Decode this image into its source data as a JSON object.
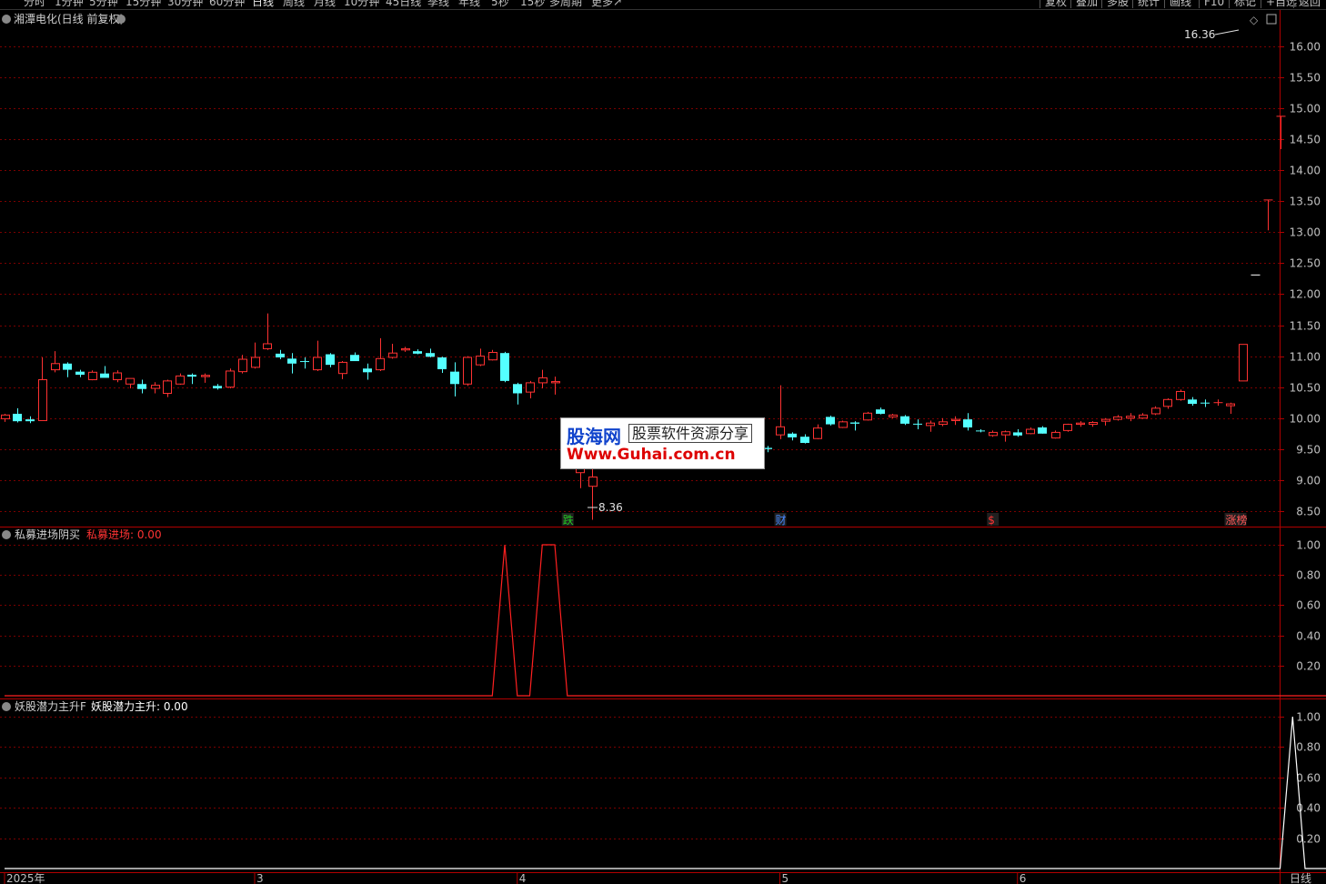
{
  "toolbar": {
    "periods": [
      "分时",
      "1分钟",
      "5分钟",
      "15分钟",
      "30分钟",
      "60分钟",
      "日线",
      "周线",
      "月线",
      "10分钟",
      "45日线",
      "季线",
      "年线",
      "5秒",
      "15秒",
      "多周期",
      "更多↗"
    ],
    "active_period": "日线",
    "buttons": [
      "复权",
      "叠加",
      "多股",
      "统计",
      "画线",
      "F10",
      "标记",
      "+自选",
      "返回"
    ]
  },
  "main": {
    "title": "湘潭电化(日线 前复权)",
    "high_label": "16.36",
    "low_label": "8.36",
    "y_ticks": [
      "16.00",
      "15.50",
      "15.00",
      "14.50",
      "14.00",
      "13.50",
      "13.00",
      "12.50",
      "12.00",
      "11.50",
      "11.00",
      "10.50",
      "10.00",
      "9.50",
      "9.00",
      "8.50"
    ],
    "markers": [
      {
        "text": "跌",
        "color": "#22cc22",
        "index": 45
      },
      {
        "text": "财",
        "color": "#4488ff",
        "index": 62
      },
      {
        "text": "$",
        "color": "#ff3333",
        "index": 79
      },
      {
        "text": "涨榜",
        "color": "#ff5555",
        "index": 98
      }
    ]
  },
  "indicator1": {
    "name": "私募进场阴买",
    "label": "私募进场: 0.00",
    "y_ticks": [
      "1.00",
      "0.80",
      "0.60",
      "0.40",
      "0.20"
    ]
  },
  "indicator2": {
    "name": "妖股潜力主升F",
    "label": "妖股潜力主升: 0.00",
    "y_ticks": [
      "1.00",
      "0.80",
      "0.60",
      "0.40",
      "0.20"
    ]
  },
  "xaxis": {
    "labels": [
      {
        "text": "2025年",
        "index": 0
      },
      {
        "text": "3",
        "index": 20
      },
      {
        "text": "4",
        "index": 41
      },
      {
        "text": "5",
        "index": 62
      },
      {
        "text": "6",
        "index": 81
      }
    ],
    "period_label": "日线"
  },
  "watermark": {
    "logo": "股海网",
    "subtitle": "股票软件资源分享",
    "url": "Www.Guhai.com.cn"
  },
  "colors": {
    "up": "#ff3232",
    "down": "#54ffff",
    "grid": "#7a0000",
    "axis_text": "#c0c0c0",
    "frame": "#b00000",
    "indicator1_line": "#ff2020",
    "indicator2_line": "#ffffff"
  },
  "chart_data": {
    "type": "candlestick",
    "y_range": [
      8.25,
      16.6
    ],
    "candles": [
      [
        9.99,
        10.07,
        9.94,
        10.05
      ],
      [
        10.07,
        10.16,
        9.93,
        9.95
      ],
      [
        9.98,
        10.03,
        9.92,
        9.95
      ],
      [
        9.96,
        10.98,
        9.96,
        10.62
      ],
      [
        10.78,
        11.08,
        10.74,
        10.88
      ],
      [
        10.88,
        10.9,
        10.66,
        10.78
      ],
      [
        10.75,
        10.78,
        10.66,
        10.7
      ],
      [
        10.62,
        10.77,
        10.61,
        10.74
      ],
      [
        10.72,
        10.84,
        10.68,
        10.65
      ],
      [
        10.62,
        10.77,
        10.58,
        10.73
      ],
      [
        10.55,
        10.62,
        10.48,
        10.64
      ],
      [
        10.55,
        10.62,
        10.4,
        10.47
      ],
      [
        10.48,
        10.58,
        10.4,
        10.53
      ],
      [
        10.4,
        10.62,
        10.34,
        10.6
      ],
      [
        10.55,
        10.72,
        10.54,
        10.68
      ],
      [
        10.7,
        10.72,
        10.55,
        10.67
      ],
      [
        10.67,
        10.72,
        10.57,
        10.69
      ],
      [
        10.52,
        10.55,
        10.46,
        10.48
      ],
      [
        10.5,
        10.8,
        10.48,
        10.76
      ],
      [
        10.75,
        11.02,
        10.72,
        10.95
      ],
      [
        10.82,
        11.22,
        10.8,
        10.98
      ],
      [
        11.12,
        11.69,
        11.1,
        11.2
      ],
      [
        11.04,
        11.1,
        10.95,
        10.98
      ],
      [
        10.96,
        11.05,
        10.72,
        10.88
      ],
      [
        10.92,
        10.98,
        10.8,
        10.91
      ],
      [
        10.78,
        11.25,
        10.76,
        10.98
      ],
      [
        11.03,
        11.05,
        10.82,
        10.86
      ],
      [
        10.72,
        10.92,
        10.63,
        10.9
      ],
      [
        11.02,
        11.06,
        10.92,
        10.92
      ],
      [
        10.8,
        10.88,
        10.62,
        10.74
      ],
      [
        10.78,
        11.29,
        10.76,
        10.96
      ],
      [
        10.98,
        11.2,
        10.96,
        11.05
      ],
      [
        11.1,
        11.15,
        11.07,
        11.12
      ],
      [
        11.08,
        11.11,
        11.03,
        11.04
      ],
      [
        11.05,
        11.12,
        10.98,
        10.99
      ],
      [
        10.98,
        10.99,
        10.73,
        10.79
      ],
      [
        10.75,
        10.9,
        10.35,
        10.55
      ],
      [
        10.55,
        11.0,
        10.52,
        10.98
      ],
      [
        10.86,
        11.12,
        10.84,
        11.0
      ],
      [
        10.94,
        11.1,
        10.93,
        11.06
      ],
      [
        11.05,
        11.07,
        10.58,
        10.6
      ],
      [
        10.55,
        10.57,
        10.22,
        10.4
      ],
      [
        10.42,
        10.6,
        10.32,
        10.57
      ],
      [
        10.57,
        10.78,
        10.48,
        10.65
      ],
      [
        10.57,
        10.67,
        10.38,
        10.59
      ],
      [
        9.88,
        9.9,
        9.48,
        9.5
      ],
      [
        9.12,
        9.35,
        8.87,
        9.3
      ],
      [
        8.9,
        9.4,
        8.36,
        9.05
      ],
      [
        9.4,
        9.42,
        9.18,
        9.38
      ],
      [
        9.52,
        9.57,
        9.48,
        9.5
      ],
      [
        9.55,
        9.58,
        9.48,
        9.56
      ],
      [
        9.48,
        9.66,
        9.43,
        9.64
      ],
      [
        9.68,
        9.8,
        9.62,
        9.74
      ],
      [
        9.66,
        9.68,
        9.52,
        9.6
      ],
      [
        9.48,
        9.52,
        9.4,
        9.45
      ],
      [
        9.52,
        9.62,
        9.48,
        9.6
      ],
      [
        9.55,
        9.78,
        9.5,
        9.71
      ],
      [
        9.72,
        9.72,
        9.62,
        9.62
      ],
      [
        9.65,
        9.66,
        9.55,
        9.6
      ],
      [
        9.67,
        9.72,
        9.62,
        9.7
      ],
      [
        9.65,
        9.67,
        9.58,
        9.6
      ],
      [
        9.52,
        9.55,
        9.45,
        9.5
      ],
      [
        9.73,
        10.53,
        9.66,
        9.86
      ],
      [
        9.75,
        9.77,
        9.64,
        9.69
      ],
      [
        9.7,
        9.74,
        9.59,
        9.6
      ],
      [
        9.67,
        9.9,
        9.66,
        9.84
      ],
      [
        10.02,
        10.04,
        9.88,
        9.9
      ],
      [
        9.85,
        9.96,
        9.84,
        9.94
      ],
      [
        9.93,
        9.95,
        9.8,
        9.91
      ],
      [
        9.97,
        10.1,
        9.96,
        10.08
      ],
      [
        10.14,
        10.17,
        10.06,
        10.07
      ],
      [
        10.02,
        10.07,
        10.0,
        10.05
      ],
      [
        10.03,
        10.05,
        9.89,
        9.91
      ],
      [
        9.91,
        9.98,
        9.82,
        9.9
      ],
      [
        9.88,
        9.96,
        9.78,
        9.92
      ],
      [
        9.9,
        10.0,
        9.87,
        9.94
      ],
      [
        9.96,
        10.03,
        9.89,
        9.98
      ],
      [
        9.98,
        10.08,
        9.8,
        9.85
      ],
      [
        9.8,
        9.82,
        9.77,
        9.79
      ],
      [
        9.72,
        9.8,
        9.7,
        9.77
      ],
      [
        9.73,
        9.8,
        9.62,
        9.78
      ],
      [
        9.77,
        9.82,
        9.7,
        9.72
      ],
      [
        9.75,
        9.85,
        9.74,
        9.82
      ],
      [
        9.85,
        9.87,
        9.75,
        9.75
      ],
      [
        9.68,
        9.8,
        9.67,
        9.77
      ],
      [
        9.8,
        9.91,
        9.78,
        9.9
      ],
      [
        9.9,
        9.95,
        9.86,
        9.92
      ],
      [
        9.9,
        9.95,
        9.86,
        9.93
      ],
      [
        9.95,
        10.0,
        9.88,
        9.98
      ],
      [
        9.98,
        10.05,
        9.96,
        10.02
      ],
      [
        10.0,
        10.08,
        9.95,
        10.03
      ],
      [
        10.0,
        10.08,
        9.99,
        10.05
      ],
      [
        10.07,
        10.19,
        10.05,
        10.16
      ],
      [
        10.19,
        10.32,
        10.15,
        10.3
      ],
      [
        10.3,
        10.46,
        10.28,
        10.43
      ],
      [
        10.3,
        10.34,
        10.2,
        10.23
      ],
      [
        10.25,
        10.3,
        10.18,
        10.24
      ],
      [
        10.25,
        10.3,
        10.2,
        10.25
      ],
      [
        10.2,
        10.25,
        10.07,
        10.23
      ],
      [
        10.6,
        11.19,
        10.6,
        11.19
      ],
      [
        12.31,
        12.31,
        12.31,
        12.31
      ],
      [
        13.52,
        13.52,
        13.03,
        13.52
      ],
      [
        14.87,
        14.87,
        14.34,
        14.87
      ]
    ],
    "indicator1_series": [
      0,
      0,
      0,
      0,
      0,
      0,
      0,
      0,
      0,
      0,
      0,
      0,
      0,
      0,
      0,
      0,
      0,
      0,
      0,
      0,
      0,
      0,
      0,
      0,
      0,
      0,
      0,
      0,
      0,
      0,
      0,
      0,
      0,
      0,
      0,
      0,
      0,
      0,
      0,
      0,
      1,
      0,
      0,
      1,
      1,
      0,
      0,
      0,
      0,
      0,
      0,
      0,
      0,
      0,
      0,
      0,
      0,
      0,
      0,
      0,
      0,
      0,
      0,
      0,
      0,
      0,
      0,
      0,
      0,
      0,
      0,
      0,
      0,
      0,
      0,
      0,
      0,
      0,
      0,
      0,
      0,
      0,
      0,
      0,
      0,
      0,
      0,
      0,
      0,
      0,
      0,
      0,
      0,
      0,
      0,
      0,
      0,
      0,
      0,
      0,
      0,
      0,
      0,
      0,
      0
    ],
    "indicator2_series": [
      0,
      0,
      0,
      0,
      0,
      0,
      0,
      0,
      0,
      0,
      0,
      0,
      0,
      0,
      0,
      0,
      0,
      0,
      0,
      0,
      0,
      0,
      0,
      0,
      0,
      0,
      0,
      0,
      0,
      0,
      0,
      0,
      0,
      0,
      0,
      0,
      0,
      0,
      0,
      0,
      0,
      0,
      0,
      0,
      0,
      0,
      0,
      0,
      0,
      0,
      0,
      0,
      0,
      0,
      0,
      0,
      0,
      0,
      0,
      0,
      0,
      0,
      0,
      0,
      0,
      0,
      0,
      0,
      0,
      0,
      0,
      0,
      0,
      0,
      0,
      0,
      0,
      0,
      0,
      0,
      0,
      0,
      0,
      0,
      0,
      0,
      0,
      0,
      0,
      0,
      0,
      0,
      0,
      0,
      0,
      0,
      0,
      0,
      0,
      0,
      0,
      0,
      0,
      1,
      0
    ]
  }
}
